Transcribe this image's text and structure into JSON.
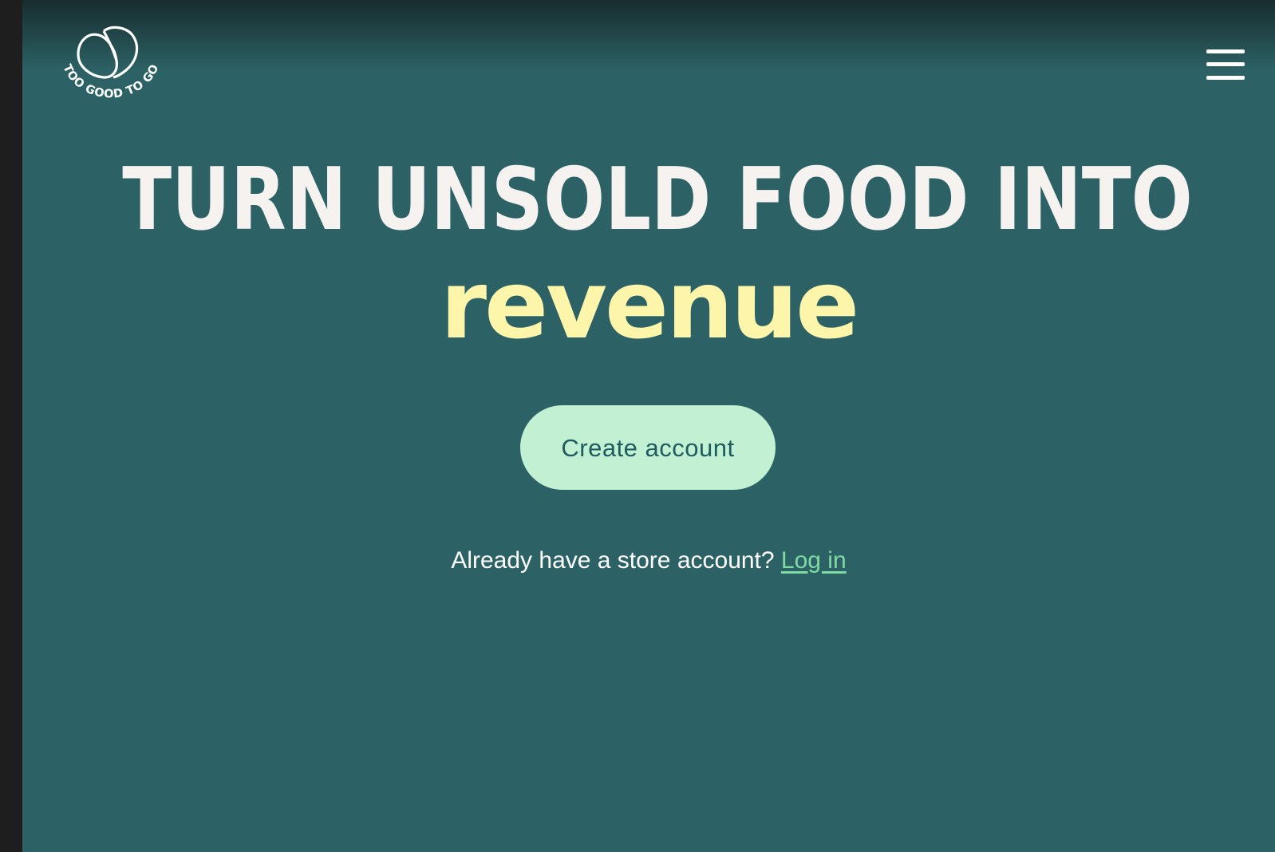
{
  "brand": {
    "name": "TOO GOOD TO GO",
    "logo_icon": "heart-bag-logo-icon"
  },
  "header": {
    "menu_icon": "hamburger-menu-icon"
  },
  "hero": {
    "headline": "TURN UNSOLD FOOD INTO",
    "accent_word": "revenue",
    "cta_label": "Create account",
    "login_prompt": "Already have a store account?",
    "login_link": "Log in"
  },
  "colors": {
    "background": "#2c6266",
    "headline": "#f6f2ef",
    "accent": "#fdf5a9",
    "cta_background": "#c1f1d2",
    "cta_text": "#1f5b5f",
    "link": "#7fd9a3",
    "frame": "#1e1e1e"
  }
}
